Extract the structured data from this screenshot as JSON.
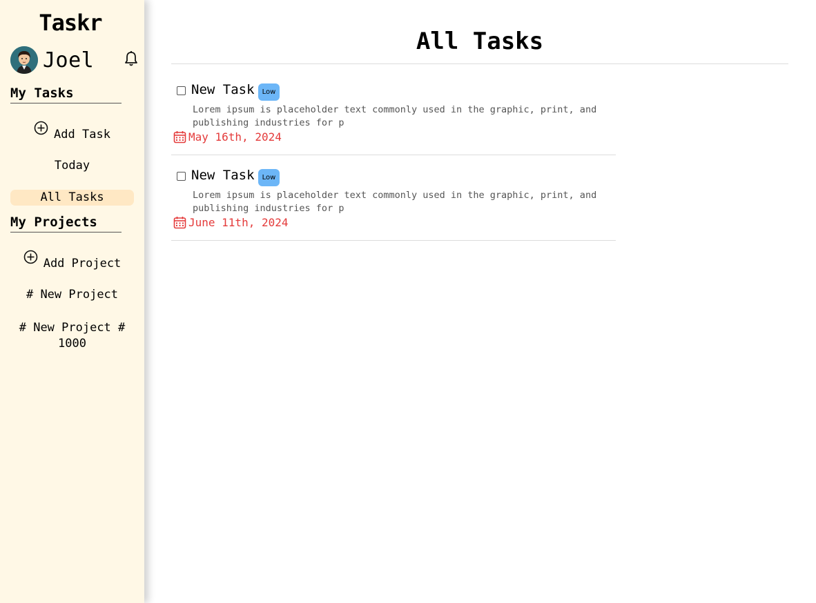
{
  "app": {
    "name": "Taskr"
  },
  "user": {
    "name": "Joel"
  },
  "sidebar": {
    "my_tasks_title": "My Tasks",
    "add_task_label": "Add Task",
    "today_label": "Today",
    "all_tasks_label": "All Tasks",
    "my_projects_title": "My Projects",
    "add_project_label": "Add Project",
    "projects": [
      {
        "label": "# New Project"
      },
      {
        "label": "# New Project # 1000"
      }
    ]
  },
  "main": {
    "title": "All Tasks",
    "tasks": [
      {
        "title": "New Task",
        "priority": "Low",
        "description": "Lorem ipsum is placeholder text commonly used in the graphic, print, and publishing industries for p",
        "due": "May 16th, 2024",
        "checked": false
      },
      {
        "title": "New Task",
        "priority": "Low",
        "description": "Lorem ipsum is placeholder text commonly used in the graphic, print, and publishing industries for p",
        "due": "June 11th, 2024",
        "checked": false
      }
    ]
  },
  "colors": {
    "sidebar_bg": "#fff8e6",
    "active_item_bg": "#ffe8c4",
    "priority_low": "#6cb6f7",
    "due_date": "#e43b3b"
  },
  "icons": [
    "avatar",
    "bell-icon",
    "plus-circle-icon",
    "calendar-icon"
  ]
}
